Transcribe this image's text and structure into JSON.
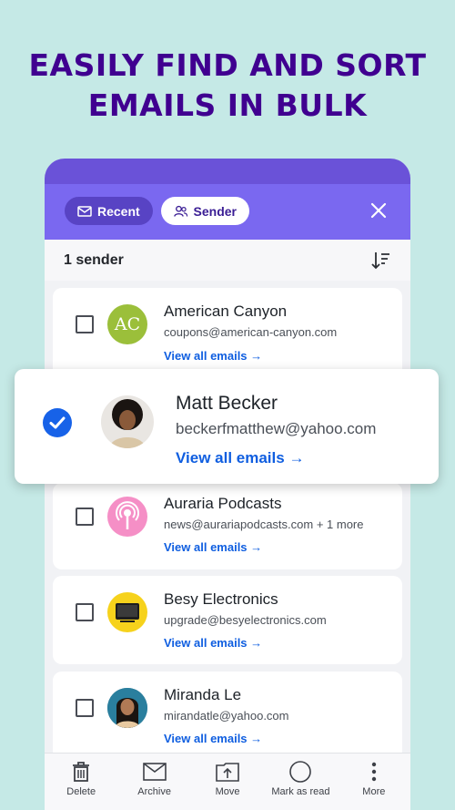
{
  "headline": {
    "line1": "EASILY FIND AND SORT",
    "line2": "EMAILS IN BULK"
  },
  "appbar": {
    "chip_recent": "Recent",
    "chip_sender": "Sender"
  },
  "subhead": {
    "count": "1 sender"
  },
  "senders": [
    {
      "name": "American Canyon",
      "email": "coupons@american-canyon.com",
      "link": "View all emails",
      "avatar_text": "AC",
      "checked": false
    },
    {
      "name": "Matt Becker",
      "email": "beckerfmatthew@yahoo.com",
      "link": "View all emails",
      "checked": true
    },
    {
      "name": "Auraria Podcasts",
      "email": "news@aurariapodcasts.com + 1 more",
      "link": "View all emails",
      "checked": false
    },
    {
      "name": "Besy Electronics",
      "email": "upgrade@besyelectronics.com",
      "link": "View all emails",
      "checked": false
    },
    {
      "name": "Miranda Le",
      "email": "mirandatle@yahoo.com",
      "link": "View all emails",
      "checked": false
    }
  ],
  "bottombar": [
    {
      "label": "Delete",
      "icon": "trash-icon"
    },
    {
      "label": "Archive",
      "icon": "archive-icon"
    },
    {
      "label": "Move",
      "icon": "move-icon"
    },
    {
      "label": "Mark as read",
      "icon": "circle-icon"
    },
    {
      "label": "More",
      "icon": "more-icon"
    }
  ],
  "colors": {
    "background": "#c5e9e6",
    "headline": "#400090",
    "accent": "#7a68f0",
    "link": "#0f5ee0",
    "checked": "#1762e8"
  }
}
